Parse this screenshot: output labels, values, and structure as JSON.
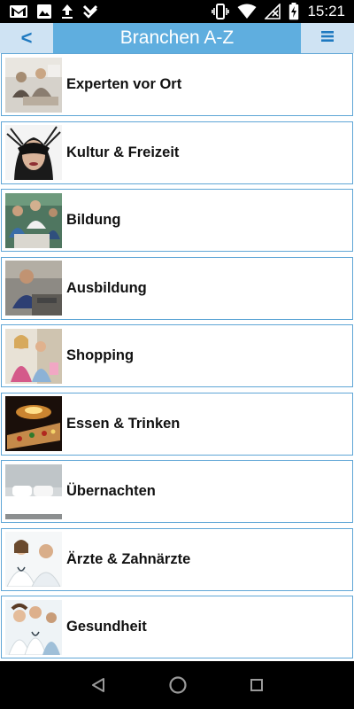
{
  "status_bar": {
    "time": "15:21",
    "left_icons": [
      "gmail-icon",
      "gallery-icon",
      "upload-icon",
      "download-done-icon"
    ],
    "right_icons": [
      "vibrate-icon",
      "wifi-icon",
      "no-signal-icon",
      "battery-charging-icon"
    ]
  },
  "header": {
    "title": "Branchen A-Z",
    "back_label": "<",
    "menu_icon": "hamburger-menu-icon",
    "background_color": "#5faedf",
    "button_color": "#cfe3f3"
  },
  "categories": [
    {
      "label": "Experten vor Ort",
      "image": "people-office-photo"
    },
    {
      "label": "Kultur & Freizeit",
      "image": "masked-woman-photo"
    },
    {
      "label": "Bildung",
      "image": "students-meeting-photo"
    },
    {
      "label": "Ausbildung",
      "image": "trainee-workshop-photo"
    },
    {
      "label": "Shopping",
      "image": "shopping-women-photo"
    },
    {
      "label": "Essen & Trinken",
      "image": "pizza-photo"
    },
    {
      "label": "Übernachten",
      "image": "hotel-bed-photo"
    },
    {
      "label": "Ärzte & Zahnärzte",
      "image": "doctors-photo"
    },
    {
      "label": "Gesundheit",
      "image": "medical-team-photo"
    }
  ],
  "nav_bar": {
    "icons": [
      "back-triangle-icon",
      "home-circle-icon",
      "recents-square-icon"
    ]
  }
}
